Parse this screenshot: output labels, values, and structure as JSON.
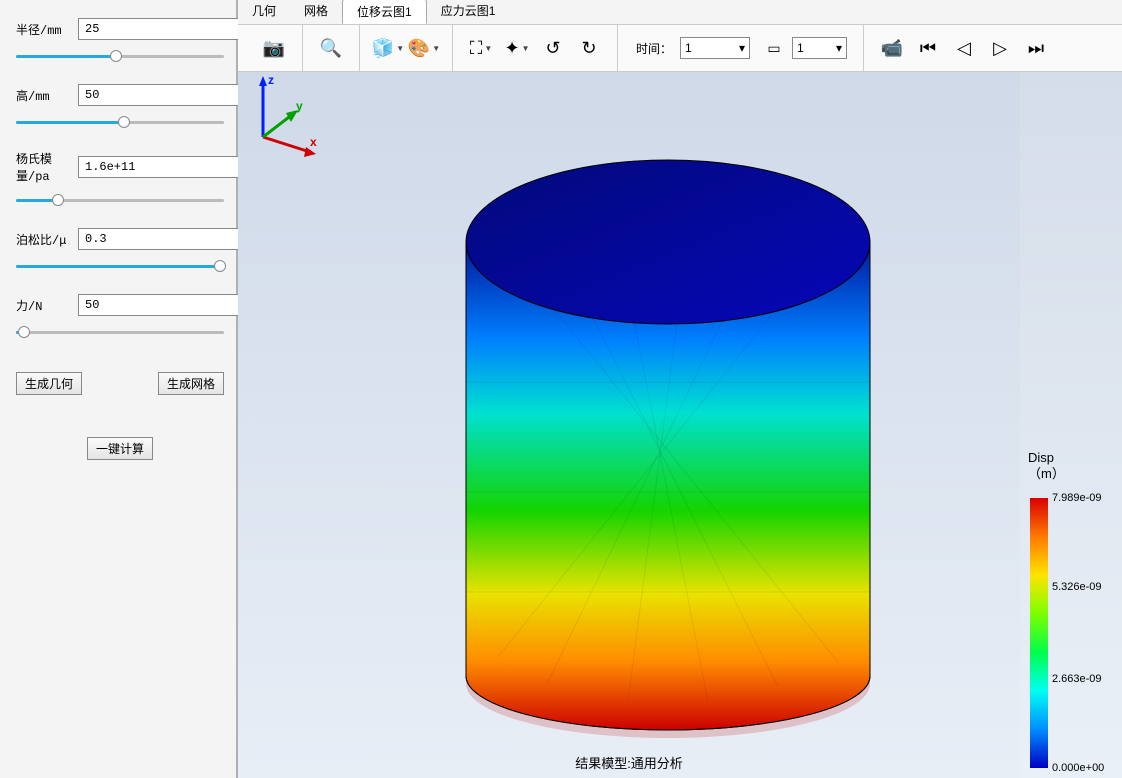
{
  "sidebar": {
    "params": [
      {
        "label": "半径/mm",
        "value": "25",
        "slider_pct": 48
      },
      {
        "label": "高/mm",
        "value": "50",
        "slider_pct": 52
      },
      {
        "label": "杨氏模量/pa",
        "value": "1.6e+11",
        "slider_pct": 20
      },
      {
        "label": "泊松比/μ",
        "value": "0.3",
        "slider_pct": 98
      },
      {
        "label": "力/N",
        "value": "50",
        "slider_pct": 4
      }
    ],
    "btn_build_geom": "生成几何",
    "btn_build_mesh": "生成网格",
    "btn_solve": "一键计算"
  },
  "tabs": {
    "items": [
      {
        "label": "几何",
        "active": false
      },
      {
        "label": "网格",
        "active": false
      },
      {
        "label": "位移云图1",
        "active": true
      },
      {
        "label": "应力云图1",
        "active": false
      }
    ]
  },
  "toolbar": {
    "grp1": [
      {
        "name": "screenshot-icon",
        "glyph": "📷"
      }
    ],
    "grp2": [
      {
        "name": "zoom-icon",
        "glyph": "🔍"
      }
    ],
    "grp3": [
      {
        "name": "transparency-icon",
        "glyph": "🧊",
        "dd": true
      },
      {
        "name": "colormap-icon",
        "glyph": "🎨",
        "dd": true
      }
    ],
    "grp4": [
      {
        "name": "fit-view-icon",
        "glyph": "⛶",
        "dd": true
      },
      {
        "name": "axis-icon",
        "glyph": "✦",
        "dd": true
      },
      {
        "name": "rotate-ccw-icon",
        "glyph": "↺"
      },
      {
        "name": "rotate-cw-icon",
        "glyph": "↻"
      }
    ],
    "time_label": "时间：",
    "time_value1": "1",
    "time_value2": "1",
    "grp_anim": [
      {
        "name": "camera-anim-icon",
        "glyph": "📹"
      },
      {
        "name": "first-frame-icon",
        "glyph": "⏮"
      },
      {
        "name": "prev-frame-icon",
        "glyph": "◁"
      },
      {
        "name": "play-icon",
        "glyph": "▷"
      },
      {
        "name": "next-frame-icon",
        "glyph": "⏭"
      }
    ]
  },
  "viewport": {
    "result_title": "结果模型:通用分析",
    "axis_x": "x",
    "axis_y": "y",
    "axis_z": "z"
  },
  "colorbar": {
    "title1": "Disp",
    "title2": "（m）",
    "ticks": [
      {
        "value": "7.989e-09",
        "pct": 0
      },
      {
        "value": "5.326e-09",
        "pct": 33
      },
      {
        "value": "2.663e-09",
        "pct": 67
      },
      {
        "value": "0.000e+00",
        "pct": 100
      }
    ]
  }
}
